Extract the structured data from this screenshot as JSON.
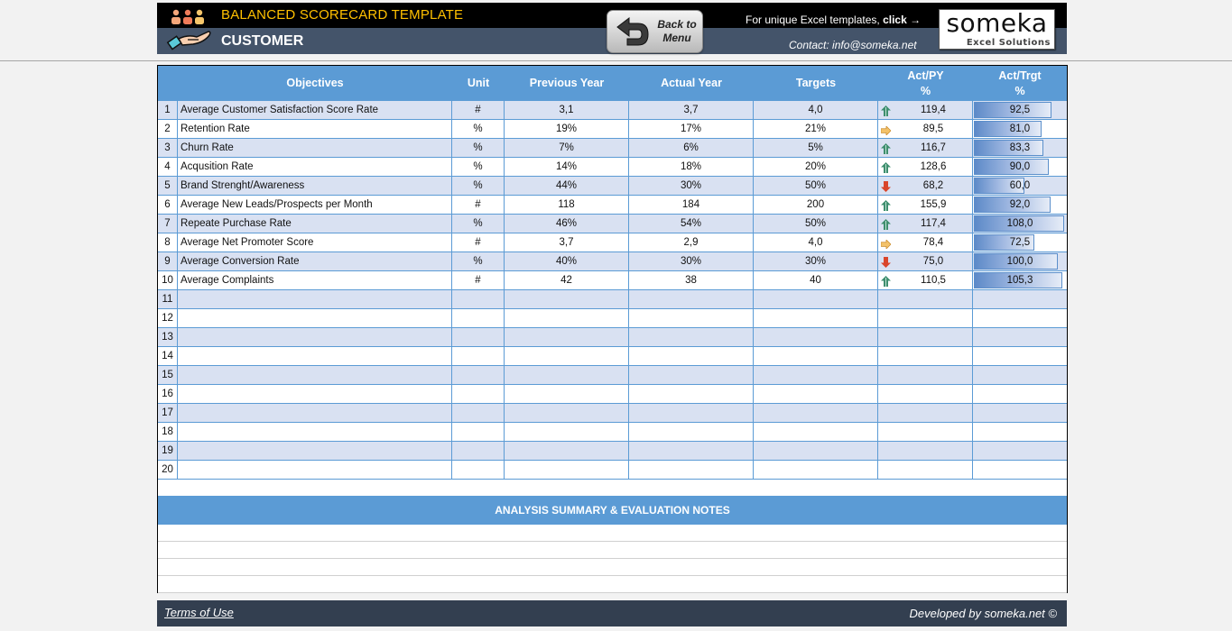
{
  "header": {
    "title": "BALANCED SCORECARD TEMPLATE",
    "subtitle": "CUSTOMER",
    "back_button_label_line1": "Back to",
    "back_button_label_line2": "Menu",
    "promo_text": "For unique Excel templates, ",
    "promo_click": "click →",
    "contact": "Contact: info@someka.net",
    "logo_word": "someka",
    "logo_sub": "Excel Solutions",
    "icons": {
      "team": "people-icon",
      "customer": "hand-icon",
      "back": "return-arrow-icon"
    }
  },
  "colors": {
    "header_black": "#000000",
    "header_slate": "#44546a",
    "title_gold": "#ffc000",
    "table_header_blue": "#5b9bd5",
    "row_band": "#d9e1f2",
    "trend_up": "#3e8e6e",
    "trend_side": "#e8a640",
    "trend_down": "#d9452b",
    "footer": "#333f50"
  },
  "table": {
    "columns": {
      "objectives": "Objectives",
      "unit": "Unit",
      "previous_year": "Previous Year",
      "actual_year": "Actual Year",
      "targets": "Targets",
      "act_py_line1": "Act/PY",
      "act_py_line2": "%",
      "act_trgt_line1": "Act/Trgt",
      "act_trgt_line2": "%"
    },
    "rows": [
      {
        "n": "1",
        "objective": "Average Customer Satisfaction Score Rate",
        "unit": "#",
        "prev": "3,1",
        "actual": "3,7",
        "target": "4,0",
        "trend": "up",
        "act_py": "119,4",
        "act_trgt": "92,5",
        "act_trgt_value": 92.5
      },
      {
        "n": "2",
        "objective": "Retention Rate",
        "unit": "%",
        "prev": "19%",
        "actual": "17%",
        "target": "21%",
        "trend": "side",
        "act_py": "89,5",
        "act_trgt": "81,0",
        "act_trgt_value": 81.0
      },
      {
        "n": "3",
        "objective": "Churn Rate",
        "unit": "%",
        "prev": "7%",
        "actual": "6%",
        "target": "5%",
        "trend": "up",
        "act_py": "116,7",
        "act_trgt": "83,3",
        "act_trgt_value": 83.3
      },
      {
        "n": "4",
        "objective": "Acqusition Rate",
        "unit": "%",
        "prev": "14%",
        "actual": "18%",
        "target": "20%",
        "trend": "up",
        "act_py": "128,6",
        "act_trgt": "90,0",
        "act_trgt_value": 90.0
      },
      {
        "n": "5",
        "objective": "Brand Strenght/Awareness",
        "unit": "%",
        "prev": "44%",
        "actual": "30%",
        "target": "50%",
        "trend": "down",
        "act_py": "68,2",
        "act_trgt": "60,0",
        "act_trgt_value": 60.0
      },
      {
        "n": "6",
        "objective": "Average New Leads/Prospects per Month",
        "unit": "#",
        "prev": "118",
        "actual": "184",
        "target": "200",
        "trend": "up",
        "act_py": "155,9",
        "act_trgt": "92,0",
        "act_trgt_value": 92.0
      },
      {
        "n": "7",
        "objective": "Repeate Purchase Rate",
        "unit": "%",
        "prev": "46%",
        "actual": "54%",
        "target": "50%",
        "trend": "up",
        "act_py": "117,4",
        "act_trgt": "108,0",
        "act_trgt_value": 108.0
      },
      {
        "n": "8",
        "objective": "Average Net Promoter Score",
        "unit": "#",
        "prev": "3,7",
        "actual": "2,9",
        "target": "4,0",
        "trend": "side",
        "act_py": "78,4",
        "act_trgt": "72,5",
        "act_trgt_value": 72.5
      },
      {
        "n": "9",
        "objective": "Average Conversion Rate",
        "unit": "%",
        "prev": "40%",
        "actual": "30%",
        "target": "30%",
        "trend": "down",
        "act_py": "75,0",
        "act_trgt": "100,0",
        "act_trgt_value": 100.0
      },
      {
        "n": "10",
        "objective": "Average Complaints",
        "unit": "#",
        "prev": "42",
        "actual": "38",
        "target": "40",
        "trend": "up",
        "act_py": "110,5",
        "act_trgt": "105,3",
        "act_trgt_value": 105.3
      },
      {
        "n": "11",
        "objective": "",
        "unit": "",
        "prev": "",
        "actual": "",
        "target": "",
        "trend": "",
        "act_py": "",
        "act_trgt": ""
      },
      {
        "n": "12",
        "objective": "",
        "unit": "",
        "prev": "",
        "actual": "",
        "target": "",
        "trend": "",
        "act_py": "",
        "act_trgt": ""
      },
      {
        "n": "13",
        "objective": "",
        "unit": "",
        "prev": "",
        "actual": "",
        "target": "",
        "trend": "",
        "act_py": "",
        "act_trgt": ""
      },
      {
        "n": "14",
        "objective": "",
        "unit": "",
        "prev": "",
        "actual": "",
        "target": "",
        "trend": "",
        "act_py": "",
        "act_trgt": ""
      },
      {
        "n": "15",
        "objective": "",
        "unit": "",
        "prev": "",
        "actual": "",
        "target": "",
        "trend": "",
        "act_py": "",
        "act_trgt": ""
      },
      {
        "n": "16",
        "objective": "",
        "unit": "",
        "prev": "",
        "actual": "",
        "target": "",
        "trend": "",
        "act_py": "",
        "act_trgt": ""
      },
      {
        "n": "17",
        "objective": "",
        "unit": "",
        "prev": "",
        "actual": "",
        "target": "",
        "trend": "",
        "act_py": "",
        "act_trgt": ""
      },
      {
        "n": "18",
        "objective": "",
        "unit": "",
        "prev": "",
        "actual": "",
        "target": "",
        "trend": "",
        "act_py": "",
        "act_trgt": ""
      },
      {
        "n": "19",
        "objective": "",
        "unit": "",
        "prev": "",
        "actual": "",
        "target": "",
        "trend": "",
        "act_py": "",
        "act_trgt": ""
      },
      {
        "n": "20",
        "objective": "",
        "unit": "",
        "prev": "",
        "actual": "",
        "target": "",
        "trend": "",
        "act_py": "",
        "act_trgt": ""
      }
    ],
    "act_trgt_bar_scale_max": 110
  },
  "notes": {
    "title": "ANALYSIS SUMMARY & EVALUATION NOTES",
    "lines": [
      "",
      "",
      "",
      ""
    ]
  },
  "footer": {
    "terms": "Terms of Use",
    "developed_by": "Developed by someka.net ©"
  }
}
